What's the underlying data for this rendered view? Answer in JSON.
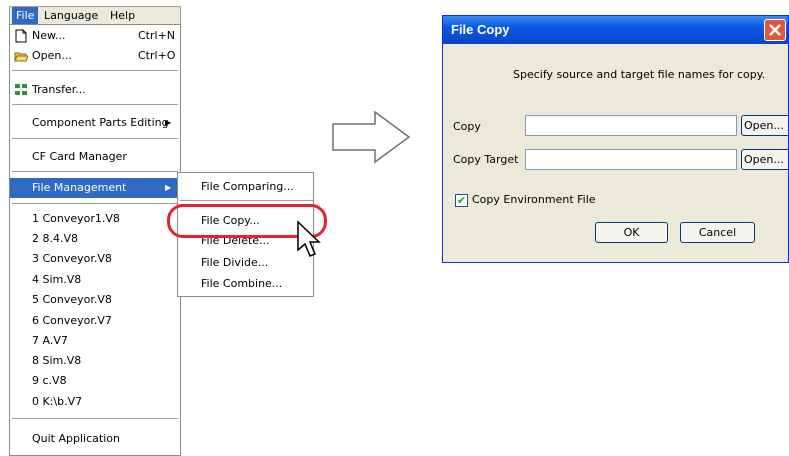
{
  "menubar": {
    "file": "File",
    "language": "Language",
    "help": "Help"
  },
  "file_menu": {
    "items": [
      {
        "label": "New...",
        "shortcut": "Ctrl+N",
        "icon": "new-file-icon"
      },
      {
        "label": "Open...",
        "shortcut": "Ctrl+O",
        "icon": "open-folder-icon"
      },
      {
        "label": "Transfer...",
        "icon": "transfer-icon"
      },
      {
        "label": "Component Parts Editing"
      },
      {
        "label": "CF Card Manager"
      },
      {
        "label": "File Management"
      },
      {
        "label": "1 Conveyor1.V8"
      },
      {
        "label": "2 8.4.V8"
      },
      {
        "label": "3 Conveyor.V8"
      },
      {
        "label": "4 Sim.V8"
      },
      {
        "label": "5 Conveyor.V8"
      },
      {
        "label": "6 Conveyor.V7"
      },
      {
        "label": "7 A.V7"
      },
      {
        "label": "8 Sim.V8"
      },
      {
        "label": "9 c.V8"
      },
      {
        "label": "0 K:\\b.V7"
      },
      {
        "label": "Quit Application"
      }
    ]
  },
  "submenu": {
    "items": [
      {
        "label": "File Comparing..."
      },
      {
        "label": "File Copy..."
      },
      {
        "label": "File Delete..."
      },
      {
        "label": "File Divide..."
      },
      {
        "label": "File Combine..."
      }
    ]
  },
  "dialog": {
    "title": "File Copy",
    "instruction": "Specify source and target file names for copy.",
    "copy_label": "Copy",
    "copy_value": "",
    "copy_target_label": "Copy Target",
    "copy_target_value": "",
    "open_label": "Open...",
    "checkbox_label": "Copy Environment File",
    "checkbox_checked": true,
    "ok_label": "OK",
    "cancel_label": "Cancel"
  },
  "colors": {
    "highlight": "#316ac5",
    "callout": "#e8212e",
    "titlebar": "#0a58e0"
  }
}
